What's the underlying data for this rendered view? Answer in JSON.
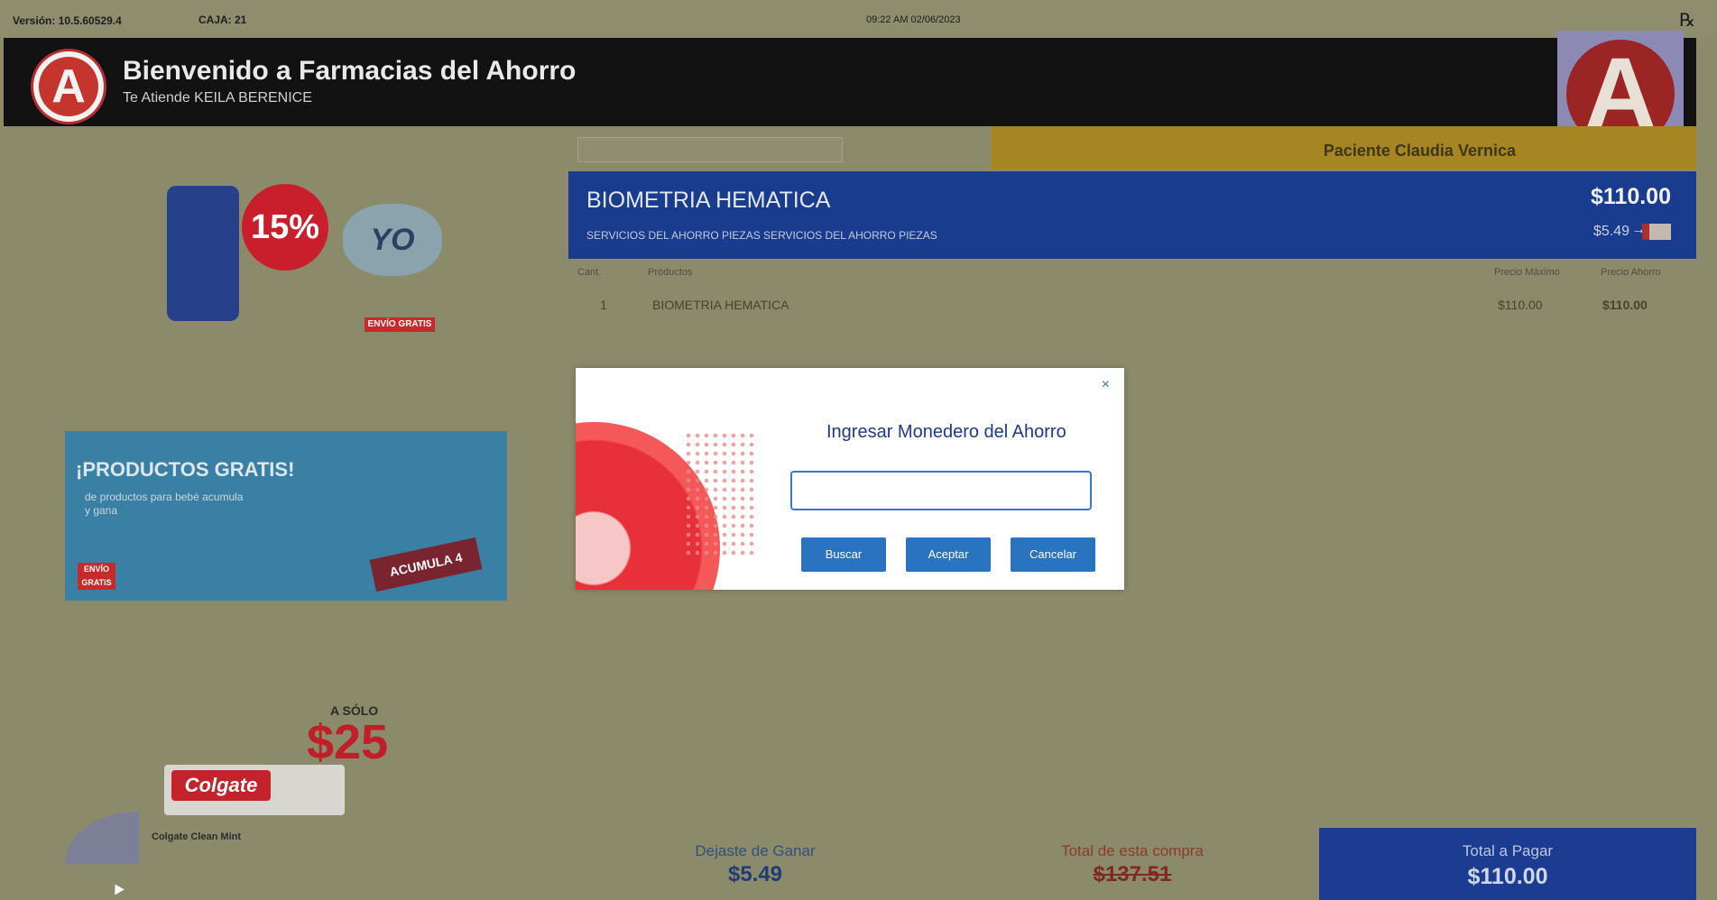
{
  "topbar": {
    "version": "Versión: 10.5.60529.4",
    "caja": "CAJA: 21",
    "datetime": "09:22 AM 02/06/2023",
    "rx": "℞"
  },
  "header": {
    "title": "Bienvenido a Farmacias del Ahorro",
    "subtitle": "Te Atiende KEILA BERENICE",
    "logo": "A"
  },
  "patient": {
    "name": "Paciente Claudia Vernica"
  },
  "item": {
    "name": "BIOMETRIA HEMATICA",
    "description": "SERVICIOS DEL AHORRO PIEZAS SERVICIOS DEL AHORRO PIEZAS",
    "price": "$110.00",
    "savings": "$5.49"
  },
  "table": {
    "headers": {
      "cant": "Cant.",
      "productos": "Productos",
      "precio_maximo": "Precio Máximo",
      "precio_ahorro": "Precio Ahorro"
    },
    "rows": [
      {
        "cant": "1",
        "producto": "BIOMETRIA HEMATICA",
        "precio_maximo": "$110.00",
        "precio_ahorro": "$110.00"
      }
    ]
  },
  "promos": {
    "promo1": {
      "badge": "15%",
      "yo": "YO",
      "envio": "ENVÍO GRATIS"
    },
    "promo2": {
      "title": "¡PRODUCTOS GRATIS!",
      "text": "de productos para bebé acumula y gana",
      "acumula": "ACUMULA 4",
      "envio": "ENVÍO GRATIS"
    },
    "promo3": {
      "asolo": "A SÓLO",
      "price": "$25",
      "brand": "Colgate",
      "product": "Colgate Clean Mint"
    }
  },
  "modal": {
    "title": "Ingresar Monedero del Ahorro",
    "input_value": "",
    "buttons": {
      "buscar": "Buscar",
      "aceptar": "Aceptar",
      "cancelar": "Cancelar"
    },
    "close": "×"
  },
  "footer": {
    "dejaste_label": "Dejaste de Ganar",
    "dejaste_value": "$5.49",
    "total_compra_label": "Total de esta compra",
    "total_compra_value": "$137.51",
    "total_pagar_label": "Total a Pagar",
    "total_pagar_value": "$110.00"
  }
}
